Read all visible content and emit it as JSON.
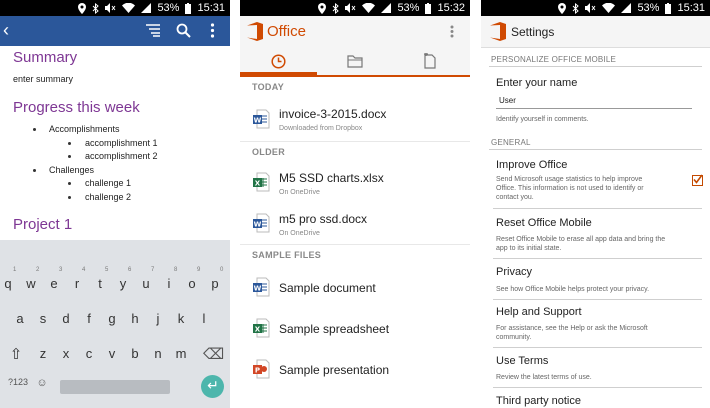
{
  "status": {
    "battery": "53%",
    "time1": "15:31",
    "time2": "15:32",
    "time3": "15:31"
  },
  "word": {
    "headings": {
      "summary": "Summary",
      "progress": "Progress this week",
      "project": "Project 1"
    },
    "summary_text": "enter summary",
    "list": {
      "accomplishments": "Accomplishments",
      "acc1": "accomplishment 1",
      "acc2": "accomplishment 2",
      "challenges": "Challenges",
      "ch1": "challenge 1",
      "ch2": "challenge 2"
    },
    "colors": {
      "toolbar": "#2b579a",
      "heading": "#7e3794"
    }
  },
  "keyboard": {
    "row1": [
      "q",
      "w",
      "e",
      "r",
      "t",
      "y",
      "u",
      "i",
      "o",
      "p"
    ],
    "row1_hints": [
      "1",
      "2",
      "3",
      "4",
      "5",
      "6",
      "7",
      "8",
      "9",
      "0"
    ],
    "row2": [
      "a",
      "s",
      "d",
      "f",
      "g",
      "h",
      "j",
      "k",
      "l"
    ],
    "row3": [
      "z",
      "x",
      "c",
      "v",
      "b",
      "n",
      "m"
    ],
    "symbols": "?123",
    "emoji": "☺",
    "shift": "⇧",
    "backspace": "⌫",
    "enter": "↵"
  },
  "office": {
    "title": "Office",
    "sections": {
      "today": "TODAY",
      "older": "OLDER",
      "samples": "SAMPLE FILES"
    },
    "files": [
      {
        "name": "invoice-3-2015.docx",
        "sub": "Downloaded from Dropbox",
        "icon": "word-file-icon"
      },
      {
        "name": "M5 SSD charts.xlsx",
        "sub": "On OneDrive",
        "icon": "excel-file-icon"
      },
      {
        "name": "m5 pro ssd.docx",
        "sub": "On OneDrive",
        "icon": "word-file-icon"
      }
    ],
    "samples": [
      {
        "name": "Sample document",
        "icon": "word-file-icon"
      },
      {
        "name": "Sample spreadsheet",
        "icon": "excel-file-icon"
      },
      {
        "name": "Sample presentation",
        "icon": "powerpoint-file-icon"
      }
    ],
    "colors": {
      "accent": "#d04a02",
      "word": "#2b579a",
      "excel": "#217346",
      "powerpoint": "#d24726"
    }
  },
  "settings": {
    "title": "Settings",
    "sec_personalize": "PERSONALIZE OFFICE MOBILE",
    "sec_general": "GENERAL",
    "name_label": "Enter your name",
    "name_value": "User",
    "name_desc": "Identify yourself in comments.",
    "improve_title": "Improve Office",
    "improve_desc1": "Send Microsoft usage statistics to help improve",
    "improve_desc2": "Office. This information is not used to identify or",
    "improve_desc3": "contact you.",
    "improve_checked": true,
    "reset_title": "Reset Office Mobile",
    "reset_desc1": "Reset Office Mobile to erase all app data and bring the",
    "reset_desc2": "app to its initial state.",
    "privacy_title": "Privacy",
    "privacy_desc": "See how Office Mobile helps protect your privacy.",
    "help_title": "Help and Support",
    "help_desc1": "For assistance, see the Help or ask the Microsoft",
    "help_desc2": "community.",
    "terms_title": "Use Terms",
    "terms_desc": "Review the latest terms of use.",
    "third_title": "Third party notice"
  }
}
